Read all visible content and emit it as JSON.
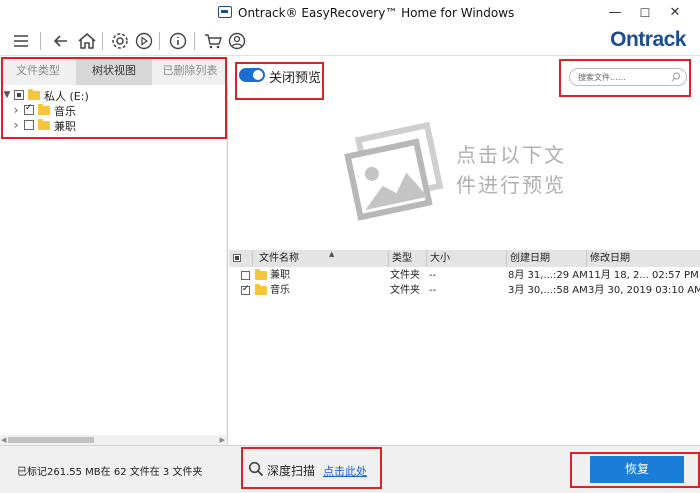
{
  "window": {
    "title": "Ontrack® EasyRecovery™ Home for Windows",
    "minimize": "—",
    "maximize": "☐",
    "close": "✕"
  },
  "toolbar": {
    "icons": [
      "menu-icon",
      "back-icon",
      "home-icon",
      "settings-icon",
      "play-icon",
      "info-icon",
      "cart-icon",
      "user-icon"
    ],
    "logo": "Ontrack"
  },
  "left_panel": {
    "tabs": [
      {
        "label": "文件类型",
        "active": false
      },
      {
        "label": "树状视图",
        "active": true
      },
      {
        "label": "已删除列表",
        "active": false
      }
    ],
    "tree": [
      {
        "label": "私人 (E:)",
        "expander": "▼",
        "checkbox": "partial"
      },
      {
        "label": "音乐",
        "expander": "›",
        "checkbox": "checked"
      },
      {
        "label": "兼职",
        "expander": "›",
        "checkbox": "unchecked"
      }
    ]
  },
  "preview": {
    "toggle_label": "关闭预览",
    "toggle_on": true,
    "search_placeholder": "搜索文件……",
    "message_line1": "点击以下文",
    "message_line2": "件进行预览"
  },
  "file_list": {
    "columns": [
      "文件名称",
      "类型",
      "大小",
      "创建日期",
      "修改日期"
    ],
    "rows": [
      {
        "name": "兼职",
        "type": "文件夹",
        "size": "--",
        "created": "8月 31,...:29 AM",
        "modified": "11月 18, 2... 02:57 PM",
        "checked": false
      },
      {
        "name": "音乐",
        "type": "文件夹",
        "size": "--",
        "created": "3月 30,...:58 AM",
        "modified": "3月 30, 2019 03:10 AM",
        "checked": true
      }
    ]
  },
  "status": {
    "marked_text": "已标记261.55 MB在 62 文件在 3 文件夹",
    "deep_scan_label": "深度扫描",
    "deep_scan_link": "点击此处",
    "restore_button": "恢复"
  },
  "colors": {
    "accent": "#1a7ed9",
    "logo": "#1c4d8c",
    "highlight": "#d9222a",
    "folder": "#f5c53b"
  }
}
